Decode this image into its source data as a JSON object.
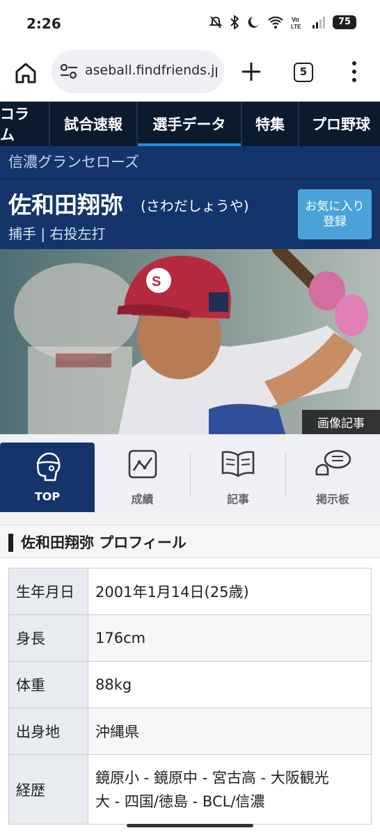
{
  "status_bar": {
    "time": "2:26",
    "battery": "75"
  },
  "browser": {
    "url": "aseball.findfriends.jp",
    "tab_count": "5"
  },
  "site_nav": {
    "items": [
      {
        "label": "コラム"
      },
      {
        "label": "試合速報"
      },
      {
        "label": "選手データ",
        "active": true
      },
      {
        "label": "特集"
      },
      {
        "label": "プロ野球"
      }
    ]
  },
  "player": {
    "team": "信濃グランセローズ",
    "name": "佐和田翔弥",
    "kana": "(さわだしょうや)",
    "position": "捕手 | 右投左打",
    "favorite_label_line1": "お気に入り",
    "favorite_label_line2": "登録",
    "photo_caption": "画像記事"
  },
  "sub_tabs": [
    {
      "label": "TOP",
      "icon": "head-icon",
      "active": true
    },
    {
      "label": "成績",
      "icon": "chart-icon"
    },
    {
      "label": "記事",
      "icon": "book-icon"
    },
    {
      "label": "掲示板",
      "icon": "chat-icon"
    }
  ],
  "profile": {
    "title": "佐和田翔弥 プロフィール",
    "rows": [
      {
        "key": "生年月日",
        "value": "2001年1月14日(25歳)"
      },
      {
        "key": "身長",
        "value": "176cm"
      },
      {
        "key": "体重",
        "value": "88kg"
      },
      {
        "key": "出身地",
        "value": "沖縄県"
      },
      {
        "key": "経歴",
        "value_line1": "鏡原小 - 鏡原中 - 宮古高 - 大阪観光",
        "value_line2": "大 - 四国/徳島 - BCL/信濃"
      }
    ]
  },
  "colors": {
    "nav_bg": "#0c1a2e",
    "header_bg": "#14356b",
    "accent": "#1e8de0",
    "favorite_bg": "#4aa3d8"
  }
}
